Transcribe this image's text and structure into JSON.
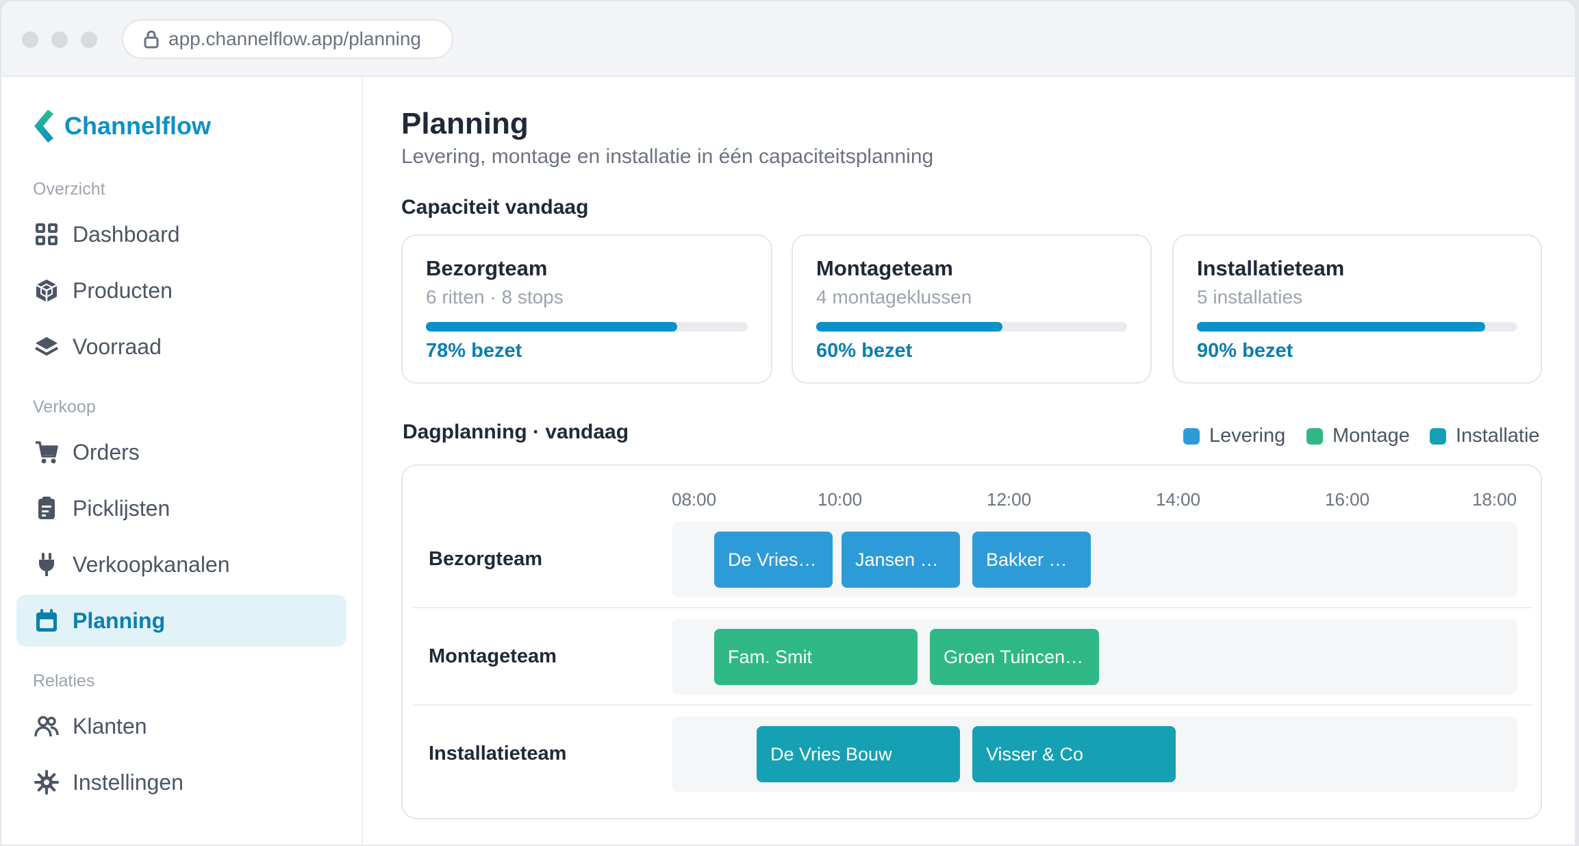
{
  "browser": {
    "url": "app.channelflow.app/planning"
  },
  "sidebar": {
    "brand": "Channelflow",
    "sections": [
      {
        "label": "Overzicht"
      },
      {
        "label": "Verkoop"
      },
      {
        "label": "Relaties"
      }
    ],
    "items": [
      {
        "label": "Dashboard",
        "icon": "dashboard-grid-icon"
      },
      {
        "label": "Producten",
        "icon": "box-icon"
      },
      {
        "label": "Voorraad",
        "icon": "layers-icon"
      },
      {
        "label": "Orders",
        "icon": "cart-icon"
      },
      {
        "label": "Picklijsten",
        "icon": "clipboard-icon"
      },
      {
        "label": "Verkoopkanalen",
        "icon": "plug-icon"
      },
      {
        "label": "Planning",
        "icon": "calendar-icon",
        "active": true
      },
      {
        "label": "Klanten",
        "icon": "users-icon"
      },
      {
        "label": "Instellingen",
        "icon": "gear-icon"
      }
    ]
  },
  "page": {
    "title": "Planning",
    "subtitle": "Levering, montage en installatie in één capaciteitsplanning"
  },
  "capacity": {
    "heading": "Capaciteit vandaag",
    "cards": [
      {
        "title": "Bezorgteam",
        "sub": "6 ritten · 8 stops",
        "percent": 78,
        "label": "78% bezet"
      },
      {
        "title": "Montageteam",
        "sub": "4 montageklussen",
        "percent": 60,
        "label": "60% bezet"
      },
      {
        "title": "Installatieteam",
        "sub": "5 installaties",
        "percent": 90,
        "label": "90% bezet"
      }
    ]
  },
  "schedule": {
    "heading": "Dagplanning · vandaag",
    "legend": [
      {
        "label": "Levering",
        "color": "#2e9bd9"
      },
      {
        "label": "Montage",
        "color": "#2fb886"
      },
      {
        "label": "Installatie",
        "color": "#16a0b3"
      }
    ],
    "times": [
      "08:00",
      "10:00",
      "12:00",
      "14:00",
      "16:00",
      "18:00"
    ],
    "rows": [
      {
        "team": "Bezorgteam",
        "jobs": [
          {
            "label": "De Vries…",
            "type": "Levering"
          },
          {
            "label": "Jansen …",
            "type": "Levering"
          },
          {
            "label": "Bakker …",
            "type": "Levering"
          }
        ]
      },
      {
        "team": "Montageteam",
        "jobs": [
          {
            "label": "Fam. Smit",
            "type": "Montage"
          },
          {
            "label": "Groen Tuincen…",
            "type": "Montage"
          }
        ]
      },
      {
        "team": "Installatieteam",
        "jobs": [
          {
            "label": "De Vries Bouw",
            "type": "Installatie"
          },
          {
            "label": "Visser & Co",
            "type": "Installatie"
          }
        ]
      }
    ]
  }
}
